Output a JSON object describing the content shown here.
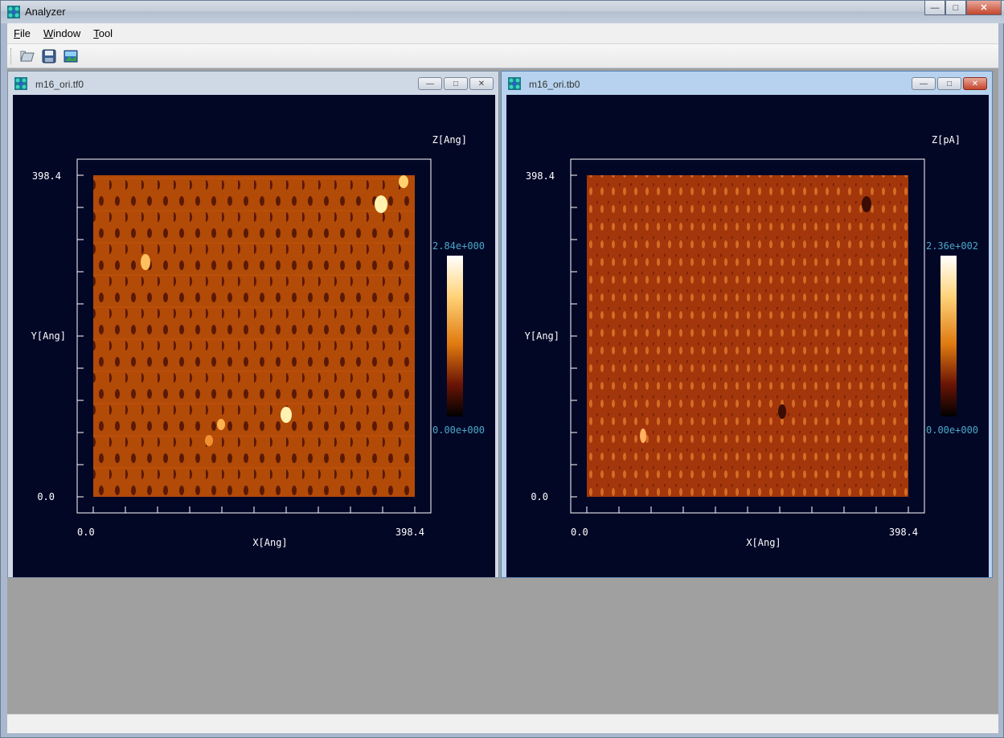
{
  "app": {
    "title": "Analyzer"
  },
  "window_controls": {
    "minimize": "—",
    "maximize": "□",
    "close": "✕"
  },
  "menu": [
    {
      "label": "File",
      "mnemonic": "F",
      "rest": "ile"
    },
    {
      "label": "Window",
      "mnemonic": "W",
      "rest": "indow"
    },
    {
      "label": "Tool",
      "mnemonic": "T",
      "rest": "ool"
    }
  ],
  "toolbar": {
    "icons": [
      "open-icon",
      "save-icon",
      "image-icon"
    ]
  },
  "windows": [
    {
      "title": "m16_ori.tf0",
      "active": false,
      "plot": {
        "z_label": "Z[Ang]",
        "y_label": "Y[Ang]",
        "x_label": "X[Ang]",
        "y_max": "398.4",
        "y_min": "0.0",
        "x_min": "0.0",
        "x_max": "398.4",
        "colorbar_max": "2.84e+000",
        "colorbar_min": "0.00e+000"
      }
    },
    {
      "title": "m16_ori.tb0",
      "active": true,
      "plot": {
        "z_label": "Z[pA]",
        "y_label": "Y[Ang]",
        "x_label": "X[Ang]",
        "y_max": "398.4",
        "y_min": "0.0",
        "x_min": "0.0",
        "x_max": "398.4",
        "colorbar_max": "2.36e+002",
        "colorbar_min": "0.00e+000"
      }
    }
  ],
  "colors": {
    "plot_background": "#030726",
    "axis": "#ffffff",
    "colorbar_label": "#4aa7c8",
    "image_base_1": "#b24a08",
    "image_base_2": "#a3360b",
    "image_pit": "#4a1004",
    "image_highlight": "#fff2b0"
  }
}
